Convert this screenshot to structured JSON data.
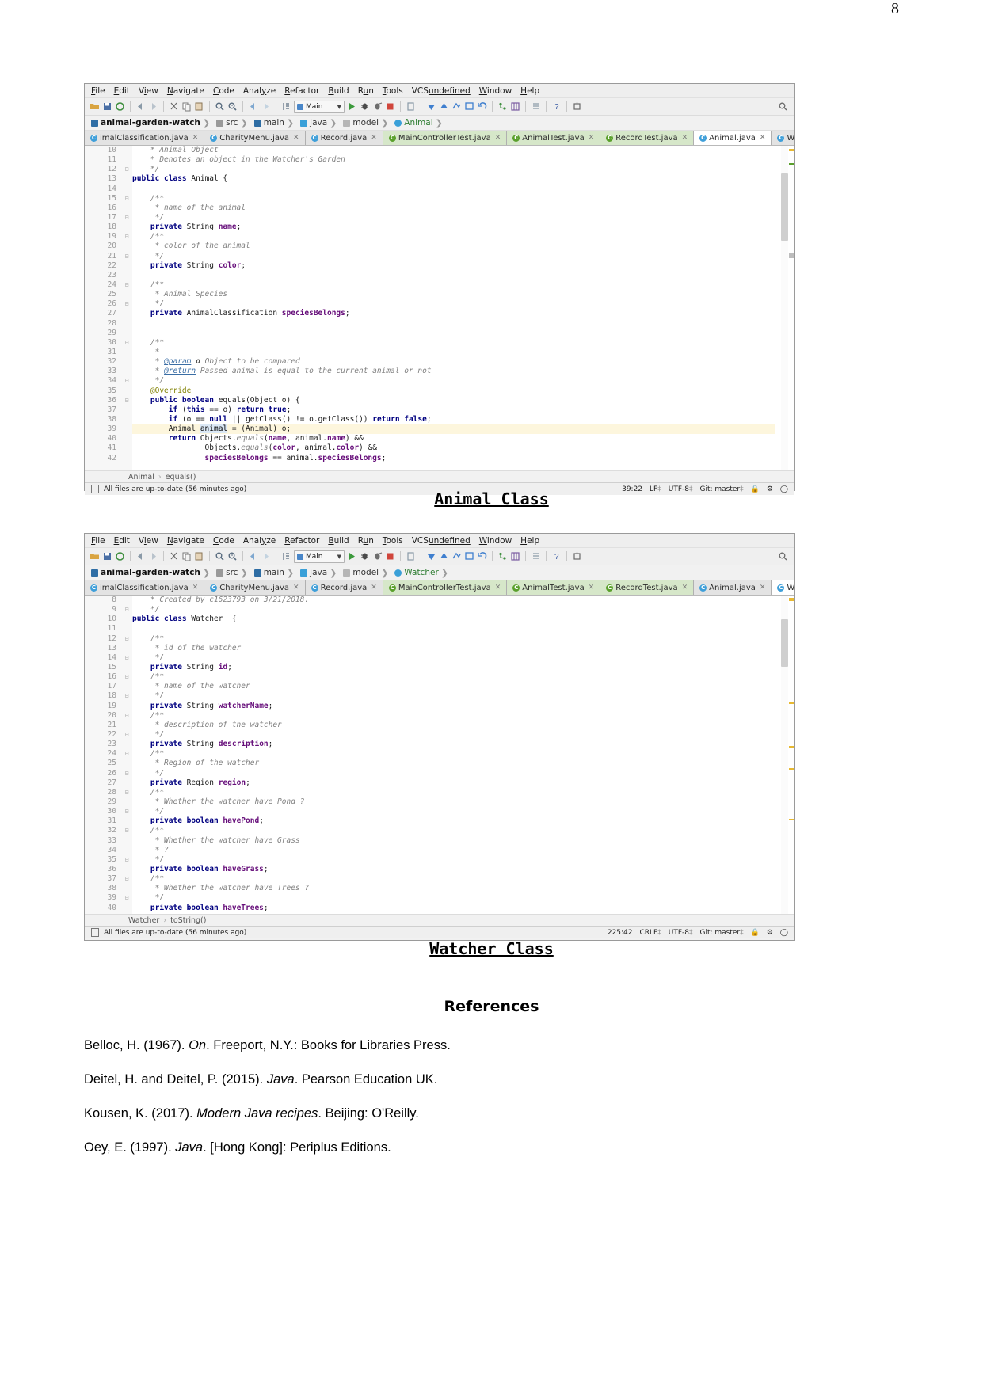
{
  "page": {
    "number": "8"
  },
  "ide": {
    "menu": [
      "File",
      "Edit",
      "View",
      "Navigate",
      "Code",
      "Analyze",
      "Refactor",
      "Build",
      "Run",
      "Tools",
      "VCS",
      "Window",
      "Help"
    ],
    "toolbar": {
      "run_config_label": "Main",
      "icons": [
        "open-folder-icon",
        "save-icon",
        "sync-icon",
        "back-arrow-icon",
        "forward-arrow-icon",
        "cut-icon",
        "copy-icon",
        "paste-icon",
        "find-icon",
        "replace-icon",
        "prev-occurrence-icon",
        "next-occurrence-icon",
        "compile-icon",
        "run-icon",
        "debug-icon",
        "run-coverage-icon",
        "stop-icon",
        "profile-icon",
        "update-project-icon",
        "commit-icon",
        "push-icon",
        "revert-icon",
        "rollback-icon",
        "branches-icon",
        "settings-icon",
        "structure-icon",
        "help-icon",
        "sdk-icon",
        "search-everywhere-icon"
      ]
    },
    "status_text": "All files are up-to-date (56 minutes ago)",
    "status_encoding": "UTF-8",
    "status_branch": "Git: master"
  },
  "animal_editor": {
    "breadcrumb": [
      "animal-garden-watch",
      "src",
      "main",
      "java",
      "model",
      "Animal"
    ],
    "tabs": [
      {
        "label": "imalClassification.java",
        "kind": "class",
        "active": false
      },
      {
        "label": "CharityMenu.java",
        "kind": "class",
        "active": false
      },
      {
        "label": "Record.java",
        "kind": "class",
        "active": false
      },
      {
        "label": "MainControllerTest.java",
        "kind": "test",
        "active": false
      },
      {
        "label": "AnimalTest.java",
        "kind": "test",
        "active": false
      },
      {
        "label": "RecordTest.java",
        "kind": "test",
        "active": false
      },
      {
        "label": "Animal.java",
        "kind": "class",
        "active": true
      },
      {
        "label": "Watcher.java",
        "kind": "class",
        "active": false
      }
    ],
    "tabs_overflow": "»",
    "first_line_number": 10,
    "code": [
      {
        "n": 10,
        "html": "    <span class=\"cm\">* Animal Object</span>"
      },
      {
        "n": 11,
        "html": "    <span class=\"cm\">* Denotes an object in the Watcher's Garden</span>"
      },
      {
        "n": 12,
        "html": "    <span class=\"cm\">*/</span>",
        "fold": true
      },
      {
        "n": 13,
        "html": "<span class=\"kw\">public class</span> <span class=\"txt\">Animal {</span>"
      },
      {
        "n": 14,
        "html": ""
      },
      {
        "n": 15,
        "html": "    <span class=\"cm\">/**</span>",
        "fold": true
      },
      {
        "n": 16,
        "html": "     <span class=\"cm\">* name of the animal</span>"
      },
      {
        "n": 17,
        "html": "     <span class=\"cm\">*/</span>",
        "fold": true
      },
      {
        "n": 18,
        "html": "    <span class=\"kw\">private</span> <span class=\"txt\">String</span> <span class=\"fld\">name</span><span class=\"txt\">;</span>"
      },
      {
        "n": 19,
        "html": "    <span class=\"cm\">/**</span>",
        "fold": true
      },
      {
        "n": 20,
        "html": "     <span class=\"cm\">* color of the animal</span>"
      },
      {
        "n": 21,
        "html": "     <span class=\"cm\">*/</span>",
        "fold": true
      },
      {
        "n": 22,
        "html": "    <span class=\"kw\">private</span> <span class=\"txt\">String</span> <span class=\"fld\">color</span><span class=\"txt\">;</span>"
      },
      {
        "n": 23,
        "html": ""
      },
      {
        "n": 24,
        "html": "    <span class=\"cm\">/**</span>",
        "fold": true
      },
      {
        "n": 25,
        "html": "     <span class=\"cm\">* Animal Species</span>"
      },
      {
        "n": 26,
        "html": "     <span class=\"cm\">*/</span>",
        "fold": true
      },
      {
        "n": 27,
        "html": "    <span class=\"kw\">private</span> <span class=\"txt\">AnimalClassification</span> <span class=\"fld\">speciesBelongs</span><span class=\"txt\">;</span>"
      },
      {
        "n": 28,
        "html": ""
      },
      {
        "n": 29,
        "html": ""
      },
      {
        "n": 30,
        "html": "    <span class=\"cm\">/**</span>",
        "fold": true
      },
      {
        "n": 31,
        "html": "     <span class=\"cm\">*</span>"
      },
      {
        "n": 32,
        "html": "     <span class=\"cm\">* </span><span class=\"cmtag\">@param</span> <span class=\"cmb\">o</span> <span class=\"cm\">Object to be compared</span>"
      },
      {
        "n": 33,
        "html": "     <span class=\"cm\">* </span><span class=\"cmtag\">@return</span> <span class=\"cm\">Passed animal is equal to the current animal or not</span>"
      },
      {
        "n": 34,
        "html": "     <span class=\"cm\">*/</span>",
        "fold": true
      },
      {
        "n": 35,
        "html": "    <span class=\"anno\">@Override</span>"
      },
      {
        "n": 36,
        "html": "    <span class=\"kw\">public boolean</span> <span class=\"txt\">equals(Object o) {</span>",
        "gutter_icon": true,
        "fold": true
      },
      {
        "n": 37,
        "html": "        <span class=\"kw\">if</span> <span class=\"txt\">(</span><span class=\"kw\">this</span> <span class=\"txt\">== o)</span> <span class=\"kw\">return true</span><span class=\"txt\">;</span>"
      },
      {
        "n": 38,
        "html": "        <span class=\"kw\">if</span> <span class=\"txt\">(o ==</span> <span class=\"kw\">null</span> <span class=\"txt\">|| getClass() != o.getClass())</span> <span class=\"kw\">return false</span><span class=\"txt\">;</span>"
      },
      {
        "n": 39,
        "html": "        <span class=\"txt\">Animal </span><span class=\"hlword\">animal</span><span class=\"txt\"> = (Animal) o;</span>",
        "highlight": true
      },
      {
        "n": 40,
        "html": "        <span class=\"kw\">return</span> <span class=\"txt\">Objects.</span><span class=\"cm\">equals</span><span class=\"txt\">(</span><span class=\"fld\">name</span><span class=\"txt\">, animal.</span><span class=\"fld\">name</span><span class=\"txt\">) &amp;&amp;</span>"
      },
      {
        "n": 41,
        "html": "                <span class=\"txt\">Objects.</span><span class=\"cm\">equals</span><span class=\"txt\">(</span><span class=\"fld\">color</span><span class=\"txt\">, animal.</span><span class=\"fld\">color</span><span class=\"txt\">) &amp;&amp;</span>"
      },
      {
        "n": 42,
        "html": "                <span class=\"fld\">speciesBelongs</span><span class=\"txt\"> == animal.</span><span class=\"fld\">speciesBelongs</span><span class=\"txt\">;</span>"
      }
    ],
    "nav_path": [
      "Animal",
      "equals()"
    ],
    "caret_position": "39:22",
    "line_separator": "LF",
    "encoding": "UTF-8"
  },
  "watcher_editor": {
    "breadcrumb": [
      "animal-garden-watch",
      "src",
      "main",
      "java",
      "model",
      "Watcher"
    ],
    "tabs": [
      {
        "label": "imalClassification.java",
        "kind": "class",
        "active": false
      },
      {
        "label": "CharityMenu.java",
        "kind": "class",
        "active": false
      },
      {
        "label": "Record.java",
        "kind": "class",
        "active": false
      },
      {
        "label": "MainControllerTest.java",
        "kind": "test",
        "active": false
      },
      {
        "label": "AnimalTest.java",
        "kind": "test",
        "active": false
      },
      {
        "label": "RecordTest.java",
        "kind": "test",
        "active": false
      },
      {
        "label": "Animal.java",
        "kind": "class",
        "active": false
      },
      {
        "label": "Watcher.java",
        "kind": "class",
        "active": true
      }
    ],
    "tabs_overflow": "»",
    "code": [
      {
        "n": 8,
        "html": "    <span class=\"cm\">* Created by c1623793 on 3/21/2018.</span>"
      },
      {
        "n": 9,
        "html": "    <span class=\"cm\">*/</span>",
        "fold": true
      },
      {
        "n": 10,
        "html": "<span class=\"kw\">public class</span> <span class=\"txt\">Watcher  {</span>"
      },
      {
        "n": 11,
        "html": ""
      },
      {
        "n": 12,
        "html": "    <span class=\"cm\">/**</span>",
        "fold": true
      },
      {
        "n": 13,
        "html": "     <span class=\"cm\">* id of the watcher</span>"
      },
      {
        "n": 14,
        "html": "     <span class=\"cm\">*/</span>",
        "fold": true
      },
      {
        "n": 15,
        "html": "    <span class=\"kw\">private</span> <span class=\"txt\">String</span> <span class=\"fld\">id</span><span class=\"txt\">;</span>"
      },
      {
        "n": 16,
        "html": "    <span class=\"cm\">/**</span>",
        "fold": true
      },
      {
        "n": 17,
        "html": "     <span class=\"cm\">* name of the watcher</span>"
      },
      {
        "n": 18,
        "html": "     <span class=\"cm\">*/</span>",
        "fold": true
      },
      {
        "n": 19,
        "html": "    <span class=\"kw\">private</span> <span class=\"txt\">String</span> <span class=\"fld\">watcherName</span><span class=\"txt\">;</span>"
      },
      {
        "n": 20,
        "html": "    <span class=\"cm\">/**</span>",
        "fold": true
      },
      {
        "n": 21,
        "html": "     <span class=\"cm\">* description of the watcher</span>"
      },
      {
        "n": 22,
        "html": "     <span class=\"cm\">*/</span>",
        "fold": true
      },
      {
        "n": 23,
        "html": "    <span class=\"kw\">private</span> <span class=\"txt\">String</span> <span class=\"fld\">description</span><span class=\"txt\">;</span>"
      },
      {
        "n": 24,
        "html": "    <span class=\"cm\">/**</span>",
        "fold": true
      },
      {
        "n": 25,
        "html": "     <span class=\"cm\">* Region of the watcher</span>"
      },
      {
        "n": 26,
        "html": "     <span class=\"cm\">*/</span>",
        "fold": true
      },
      {
        "n": 27,
        "html": "    <span class=\"kw\">private</span> <span class=\"txt\">Region</span> <span class=\"fld\">region</span><span class=\"txt\">;</span>"
      },
      {
        "n": 28,
        "html": "    <span class=\"cm\">/**</span>",
        "fold": true
      },
      {
        "n": 29,
        "html": "     <span class=\"cm\">* Whether the watcher have Pond ?</span>"
      },
      {
        "n": 30,
        "html": "     <span class=\"cm\">*/</span>",
        "fold": true
      },
      {
        "n": 31,
        "html": "    <span class=\"kw\">private boolean</span> <span class=\"fld\">havePond</span><span class=\"txt\">;</span>"
      },
      {
        "n": 32,
        "html": "    <span class=\"cm\">/**</span>",
        "fold": true
      },
      {
        "n": 33,
        "html": "     <span class=\"cm\">* Whether the watcher have Grass</span>"
      },
      {
        "n": 34,
        "html": "     <span class=\"cm\">* ?</span>"
      },
      {
        "n": 35,
        "html": "     <span class=\"cm\">*/</span>",
        "fold": true
      },
      {
        "n": 36,
        "html": "    <span class=\"kw\">private boolean</span> <span class=\"fld\">haveGrass</span><span class=\"txt\">;</span>"
      },
      {
        "n": 37,
        "html": "    <span class=\"cm\">/**</span>",
        "fold": true
      },
      {
        "n": 38,
        "html": "     <span class=\"cm\">* Whether the watcher have Trees ?</span>"
      },
      {
        "n": 39,
        "html": "     <span class=\"cm\">*/</span>",
        "fold": true
      },
      {
        "n": 40,
        "html": "    <span class=\"kw\">private boolean</span> <span class=\"fld\">haveTrees</span><span class=\"txt\">;</span>"
      }
    ],
    "nav_path": [
      "Watcher",
      "toString()"
    ],
    "caret_position": "225:42",
    "line_separator": "CRLF",
    "encoding": "UTF-8"
  },
  "captions": {
    "animal": "Animal Class",
    "watcher": "Watcher Class"
  },
  "references": {
    "heading": "References",
    "items": [
      {
        "pre": "Belloc, H. (1967). ",
        "italic": "On",
        "post": ". Freeport, N.Y.: Books for Libraries Press."
      },
      {
        "pre": "Deitel, H. and Deitel, P. (2015). ",
        "italic": "Java",
        "post": ". Pearson Education UK."
      },
      {
        "pre": "Kousen, K. (2017). ",
        "italic": "Modern Java recipes",
        "post": ". Beijing: O'Reilly."
      },
      {
        "pre": "Oey, E. (1997). ",
        "italic": "Java",
        "post": ". [Hong Kong]: Periplus Editions."
      }
    ]
  }
}
